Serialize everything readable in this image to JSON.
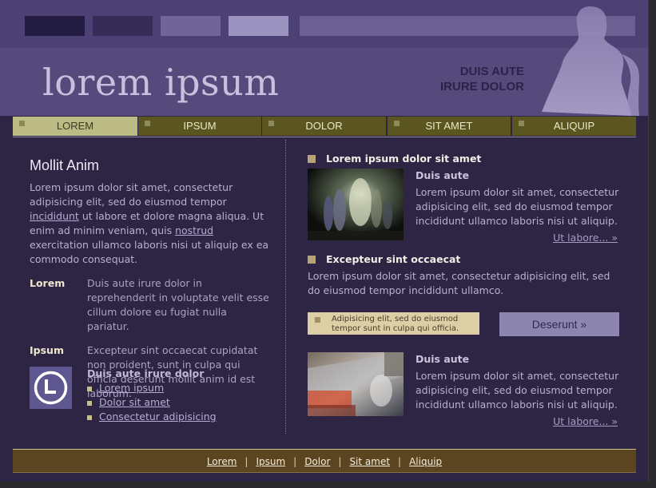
{
  "header": {
    "logo": "lorem ipsum",
    "tagline_1": "DUIS AUTE",
    "tagline_2": "IRURE DOLOR"
  },
  "nav": {
    "items": [
      {
        "label": "LOREM"
      },
      {
        "label": "IPSUM"
      },
      {
        "label": "DOLOR"
      },
      {
        "label": "SIT AMET"
      },
      {
        "label": "ALIQUIP"
      }
    ],
    "active_index": 0
  },
  "left": {
    "title": "Mollit Anim",
    "intro_1": "Lorem ipsum dolor sit amet, consectetur adipisicing elit, sed do eiusmod tempor ",
    "intro_link_1": "incididunt",
    "intro_2": " ut labore et dolore magna aliqua. Ut enim ad minim veniam, quis ",
    "intro_link_2": "nostrud",
    "intro_3": " exercitation ullamco laboris nisi ut aliquip ex ea commodo consequat.",
    "definitions": [
      {
        "term": "Lorem",
        "text": "Duis aute irure dolor in reprehenderit in voluptate velit esse cillum dolore eu fugiat nulla pariatur."
      },
      {
        "term": "Ipsum",
        "text": "Excepteur sint occaecat cupidatat non proident, sunt in culpa qui officia deserunt mollit anim id est laborum."
      }
    ],
    "links_heading": "Duis aute irure dolor",
    "links": [
      "Lorem ipsum",
      "Dolor sit amet",
      "Consectetur adipisicing"
    ]
  },
  "right": {
    "section1_heading": "Lorem ipsum dolor sit amet",
    "item1_title": "Duis aute",
    "item1_text": "Lorem ipsum dolor sit amet, consectetur adipisicing elit, sed do eiusmod tempor incididunt ullamco laboris nisi ut aliquip.",
    "item1_more": "Ut labore... »",
    "section2_heading": "Excepteur sint occaecat",
    "section2_text": "Lorem ipsum dolor sit amet, consectetur adipisicing elit, sed do eiusmod tempor incididunt ullamco.",
    "note": "Adipisicing elit, sed do eiusmod tempor sunt in culpa qui officia.",
    "button": "Deserunt »",
    "item2_title": "Duis aute",
    "item2_text": "Lorem ipsum dolor sit amet, consectetur adipisicing elit, sed do eiusmod tempor incididunt ullamco laboris nisi ut aliquip.",
    "item2_more": "Ut labore... »"
  },
  "footer": {
    "links": [
      "Lorem",
      "Ipsum",
      "Dolor",
      "Sit amet",
      "Aliquip"
    ]
  }
}
